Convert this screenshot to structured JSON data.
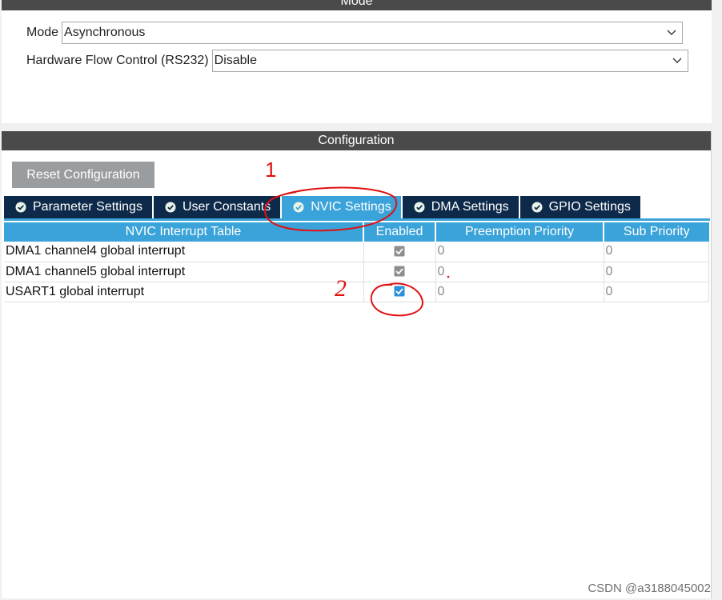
{
  "mode_section": {
    "header": "Mode",
    "mode_label": "Mode",
    "mode_value": "Asynchronous",
    "flow_label": "Hardware Flow Control (RS232)",
    "flow_value": "Disable"
  },
  "configuration": {
    "header": "Configuration",
    "reset_label": "Reset Configuration",
    "tabs": [
      {
        "label": "Parameter Settings",
        "active": false
      },
      {
        "label": "User Constants",
        "active": false
      },
      {
        "label": "NVIC Settings",
        "active": true
      },
      {
        "label": "DMA Settings",
        "active": false
      },
      {
        "label": "GPIO Settings",
        "active": false
      }
    ],
    "table": {
      "headers": [
        "NVIC Interrupt Table",
        "Enabled",
        "Preemption Priority",
        "Sub Priority"
      ],
      "rows": [
        {
          "name": "DMA1 channel4 global interrupt",
          "enabled": true,
          "locked": true,
          "preemption": "0",
          "sub": "0"
        },
        {
          "name": "DMA1 channel5 global interrupt",
          "enabled": true,
          "locked": true,
          "preemption": "0",
          "sub": "0"
        },
        {
          "name": "USART1 global interrupt",
          "enabled": true,
          "locked": false,
          "preemption": "0",
          "sub": "0"
        }
      ]
    }
  },
  "annotations": {
    "mark_1": "1",
    "mark_2": "2",
    "color": "#e01010"
  },
  "colors": {
    "tab_bg": "#0e2a4a",
    "tab_active": "#3aa3d9",
    "header_bg": "#4a4a4a"
  },
  "watermark": "CSDN @a3188045002"
}
